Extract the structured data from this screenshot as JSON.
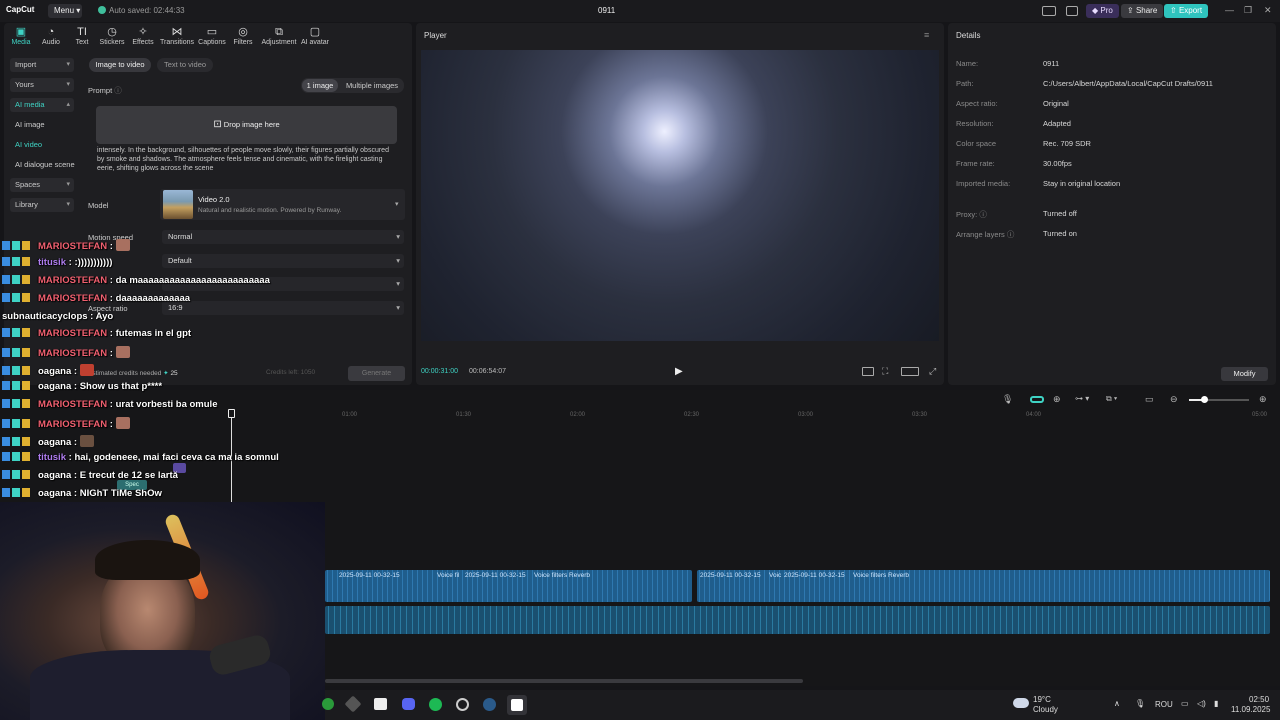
{
  "titlebar": {
    "logo": "CapCut",
    "menu": "Menu",
    "autosave": "Auto saved: 02:44:33",
    "project": "0911",
    "pro": "Pro",
    "share": "Share",
    "export": "Export"
  },
  "toolbar": [
    "Media",
    "Audio",
    "Text",
    "Stickers",
    "Effects",
    "Transitions",
    "Captions",
    "Filters",
    "Adjustment",
    "AI avatar"
  ],
  "sidebar": {
    "import": "Import",
    "yours": "Yours",
    "ai_media": "AI media",
    "ai_image": "AI image",
    "ai_video": "AI video",
    "ai_dialogue": "AI dialogue scene",
    "spaces": "Spaces",
    "library": "Library"
  },
  "generator": {
    "tab_image": "Image to video",
    "tab_text": "Text to video",
    "prompt_label": "Prompt",
    "one_image": "1 image",
    "multiple_images": "Multiple images",
    "drop_here": "Drop image here",
    "prompt_text": "intensely. In the background, silhouettes of people move slowly, their figures partially obscured by smoke and shadows. The atmosphere feels tense and cinematic, with the firelight casting eerie, shifting glows across the scene",
    "model_label": "Model",
    "model_name": "Video 2.0",
    "model_desc": "Natural and realistic motion. Powered by Runway.",
    "motion_label": "Motion speed",
    "motion_value": "Normal",
    "control_value": "Default",
    "aspect_label": "Aspect ratio",
    "aspect_value": "16:9",
    "credits_label": "Estimated credits needed",
    "credits_value": "25",
    "credits_left": "Credits left: 1050",
    "generate": "Generate"
  },
  "player": {
    "title": "Player",
    "time_current": "00:00:31:00",
    "time_total": "00:06:54:07"
  },
  "details": {
    "title": "Details",
    "rows": [
      {
        "key": "Name:",
        "value": "0911"
      },
      {
        "key": "Path:",
        "value": "C:/Users/Albert/AppData/Local/CapCut Drafts/0911"
      },
      {
        "key": "Aspect ratio:",
        "value": "Original"
      },
      {
        "key": "Resolution:",
        "value": "Adapted"
      },
      {
        "key": "Color space",
        "value": "Rec. 709 SDR"
      },
      {
        "key": "Frame rate:",
        "value": "30.00fps"
      },
      {
        "key": "Imported media:",
        "value": "Stay in original location"
      }
    ],
    "proxy_key": "Proxy:",
    "proxy_value": "Turned off",
    "arrange_key": "Arrange layers",
    "arrange_value": "Turned on",
    "modify": "Modify"
  },
  "timeline": {
    "ticks": [
      "01:00",
      "01:30",
      "02:00",
      "02:30",
      "03:00",
      "03:30",
      "04:00",
      "05:00"
    ],
    "clips": [
      "2025-09-11 00-32-15",
      "Voice fil",
      "2025-09-11 00-32-15",
      "Voice filters Reverb",
      "2025-09-11 00-32-15",
      "Voic",
      "2025-09-11 00-32-15",
      "Voice filters Reverb"
    ],
    "spec": "Spec"
  },
  "chat": [
    {
      "user": "MARIOSTEFAN",
      "msg": "",
      "emote": true,
      "kind": "m"
    },
    {
      "user": "titusik",
      "msg": ":)))))))))))",
      "emote": false,
      "kind": "t"
    },
    {
      "user": "MARIOSTEFAN",
      "msg": "da maaaaaaaaaaaaaaaaaaaaaaaaa",
      "emote": false,
      "kind": "m"
    },
    {
      "user": "MARIOSTEFAN",
      "msg": "daaaaaaaaaaaaa",
      "emote": false,
      "kind": "m"
    },
    {
      "user": "subnauticacyclops",
      "msg": "Ayo",
      "emote": false,
      "kind": "o"
    },
    {
      "user": "MARIOSTEFAN",
      "msg": "futemas in el gpt",
      "emote": false,
      "kind": "m"
    },
    {
      "user": "MARIOSTEFAN",
      "msg": "",
      "emote": true,
      "kind": "m"
    },
    {
      "user": "oagana",
      "msg": "",
      "emote": true,
      "kind": "o"
    },
    {
      "user": "oagana",
      "msg": "Show us that p****",
      "emote": false,
      "kind": "o"
    },
    {
      "user": "MARIOSTEFAN",
      "msg": "urat vorbesti ba omule",
      "emote": false,
      "kind": "m"
    },
    {
      "user": "MARIOSTEFAN",
      "msg": "",
      "emote": true,
      "kind": "m"
    },
    {
      "user": "oagana",
      "msg": "",
      "emote": true,
      "kind": "o"
    },
    {
      "user": "titusik",
      "msg": "hai, godeneee, mai faci ceva ca ma ia somnul",
      "emote": false,
      "kind": "t"
    },
    {
      "user": "oagana",
      "msg": "E trecut de 12 se lartă",
      "emote": false,
      "kind": "o"
    },
    {
      "user": "oagana",
      "msg": "NIGhT TiMe ShOw",
      "emote": false,
      "kind": "o"
    }
  ],
  "taskbar": {
    "weather_temp": "19°C",
    "weather_desc": "Cloudy",
    "lang": "ROU",
    "time": "02:50",
    "date": "11.09.2025"
  }
}
